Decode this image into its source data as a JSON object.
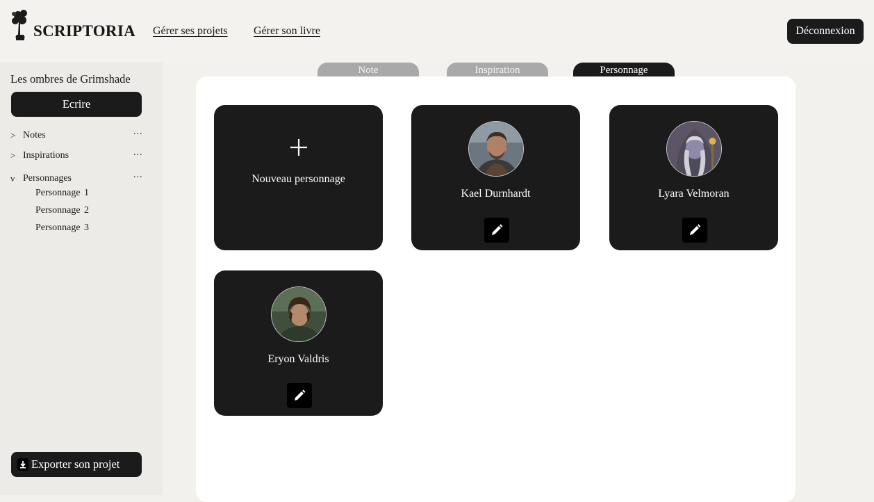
{
  "header": {
    "brand": "SCRIPTORIA",
    "nav": [
      "Gérer ses projets",
      "Gérer son livre"
    ],
    "logout_label": "Déconnexion"
  },
  "sidebar": {
    "project_title": "Les ombres de Grimshade",
    "write_label": "Ecrire",
    "sections": [
      {
        "label": "Notes",
        "chevron": ">",
        "more": "..."
      },
      {
        "label": "Inspirations",
        "chevron": ">",
        "more": "..."
      },
      {
        "label": "Personnages",
        "chevron": "v",
        "more": "...",
        "items": [
          "Personnage  1",
          "Personnage  2",
          "Personnage  3"
        ]
      }
    ],
    "export_label": "Exporter son projet"
  },
  "tabs": [
    {
      "label": "Note",
      "active": false
    },
    {
      "label": "Inspiration",
      "active": false
    },
    {
      "label": "Personnage",
      "active": true
    }
  ],
  "new_card": {
    "label": "Nouveau personnage",
    "icon": "plus-icon"
  },
  "characters": [
    {
      "name": "Kael Durnhardt",
      "avatar": "avatar-warrior-icon",
      "edit_icon": "pencil-icon"
    },
    {
      "name": "Lyara Velmoran",
      "avatar": "avatar-mage-icon",
      "edit_icon": "pencil-icon"
    },
    {
      "name": "Eryon Valdris",
      "avatar": "avatar-ranger-icon",
      "edit_icon": "pencil-icon"
    }
  ],
  "colors": {
    "dark": "#1b1b1b",
    "background": "#f2f1ee",
    "sidebar": "#ecebe7",
    "panel": "#ffffff",
    "tab_inactive": "#a9a9a9"
  }
}
